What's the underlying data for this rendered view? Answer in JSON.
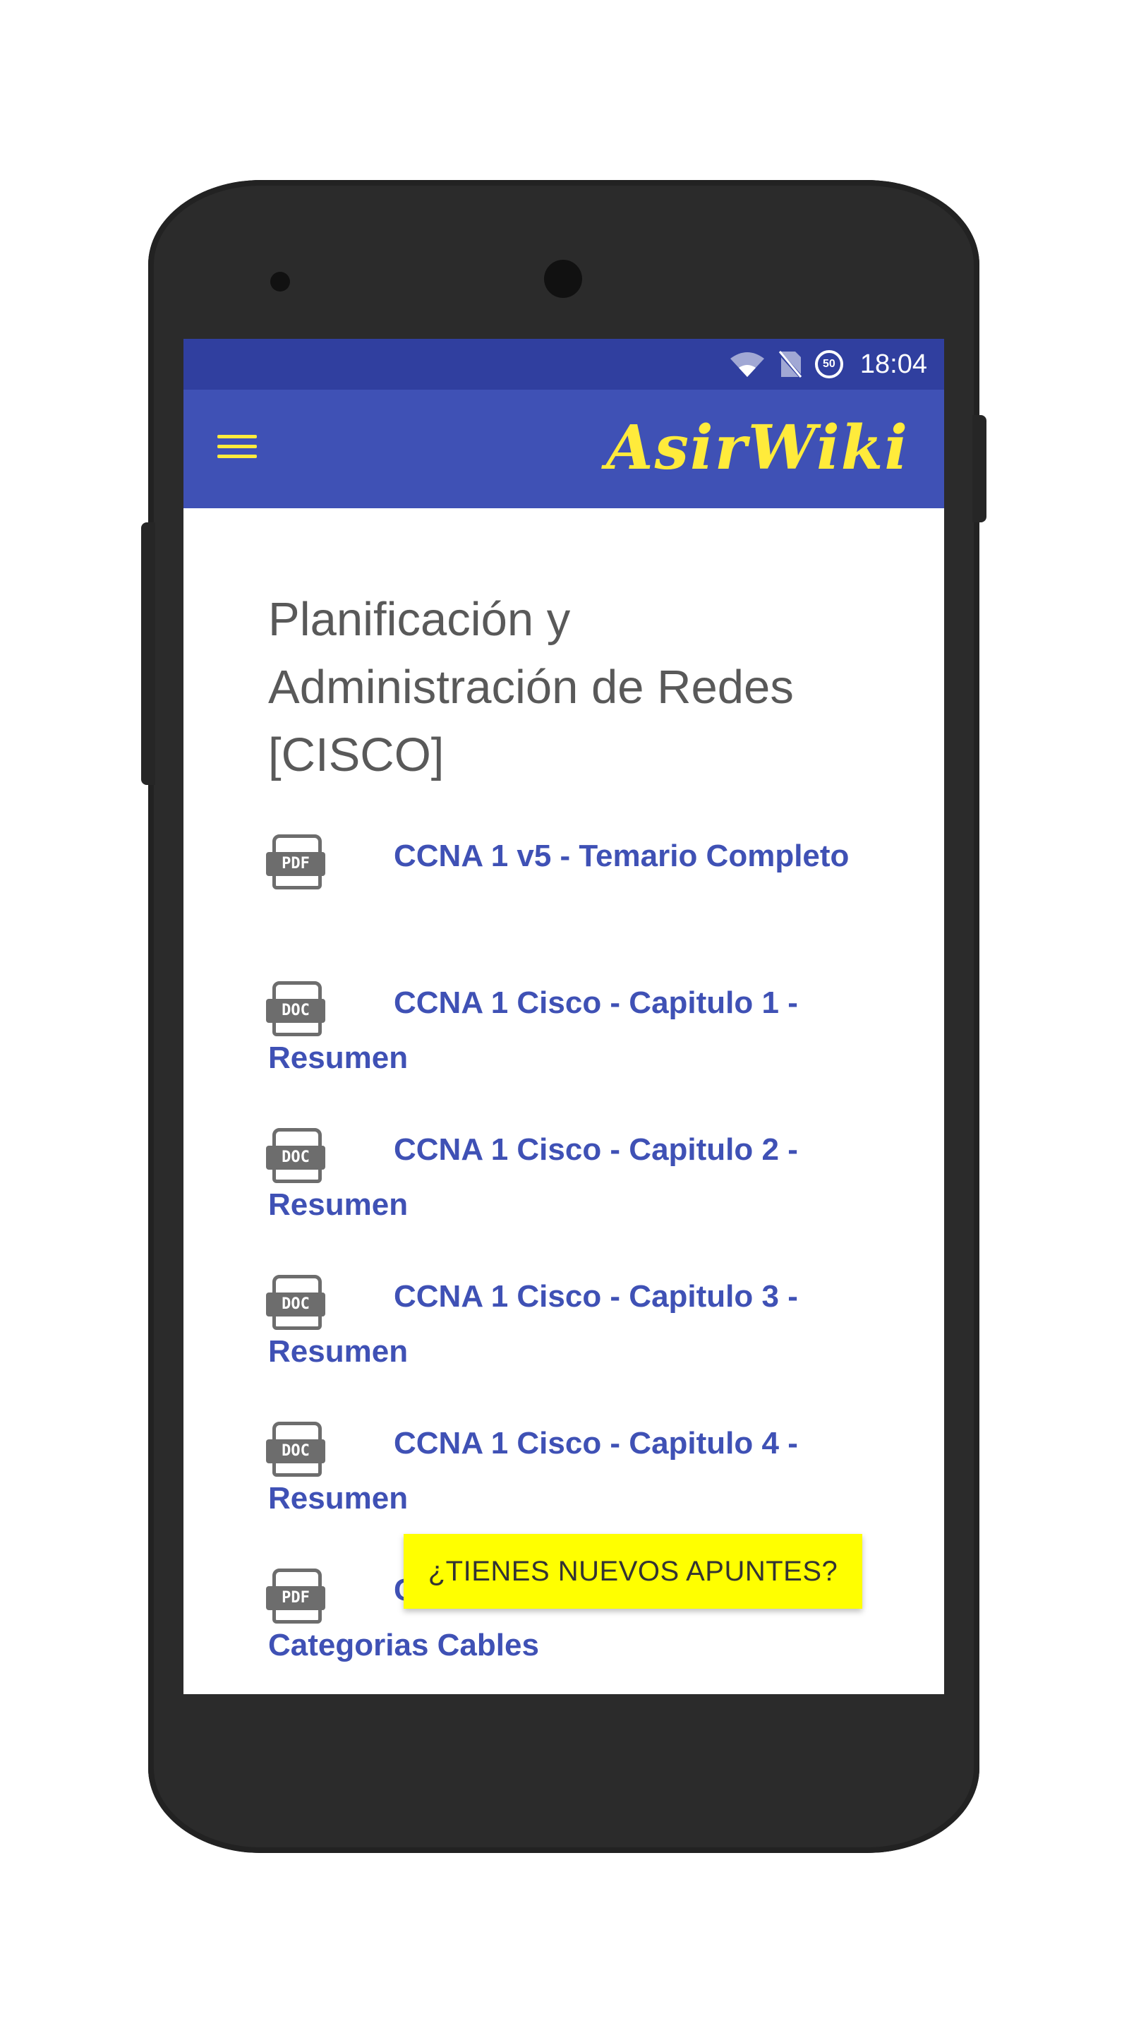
{
  "status_bar": {
    "time": "18:04",
    "data_indicator": "50",
    "icons": [
      "wifi-icon",
      "no-sim-icon",
      "data-saver-icon"
    ]
  },
  "toolbar": {
    "menu_icon": "menu-icon",
    "brand": "AsirWiki"
  },
  "page": {
    "title_line1": "Planificación y",
    "title_line2": "Administración de Redes",
    "title_line3": "[CISCO]"
  },
  "documents": [
    {
      "type": "PDF",
      "title": "CCNA 1 v5 - Temario Completo"
    },
    {
      "type": "DOC",
      "title": "CCNA 1 Cisco - Capitulo 1 - Resumen"
    },
    {
      "type": "DOC",
      "title": "CCNA 1 Cisco - Capitulo 2 - Resumen"
    },
    {
      "type": "DOC",
      "title": "CCNA 1 Cisco - Capitulo 3 - Resumen"
    },
    {
      "type": "DOC",
      "title": "CCNA 1 Cisco - Capitulo 4 - Resumen"
    },
    {
      "type": "PDF",
      "title": "CCNA 1 Cisco - Capitulo 4 - Categorias Cables"
    }
  ],
  "fab": {
    "label": "¿TIENES NUEVOS APUNTES?"
  },
  "colors": {
    "status_bar": "#303f9f",
    "toolbar": "#3f51b5",
    "accent_yellow": "#ffeb3b",
    "link_text": "#3f51b5",
    "fab_background": "#ffff00"
  }
}
